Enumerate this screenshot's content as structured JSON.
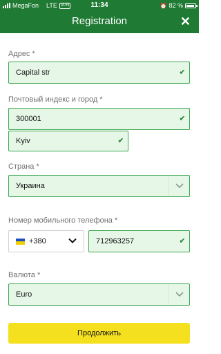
{
  "status": {
    "carrier": "MegaFon",
    "network": "LTE",
    "vpn": "VPN",
    "time": "11:34",
    "battery": "82 %"
  },
  "header": {
    "title": "Registration",
    "close": "✕"
  },
  "form": {
    "address_label": "Адрес *",
    "address_value": "Capital str",
    "postal_label": "Почтовый индекс и город *",
    "postal_value": "300001",
    "city_value": "Kyiv",
    "country_label": "Страна *",
    "country_value": "Украина",
    "phone_label": "Номер мобильного телефона *",
    "phone_prefix": "+380",
    "phone_value": "712963257",
    "currency_label": "Валюта *",
    "currency_value": "Euro"
  },
  "actions": {
    "continue_label": "Продолжить"
  }
}
